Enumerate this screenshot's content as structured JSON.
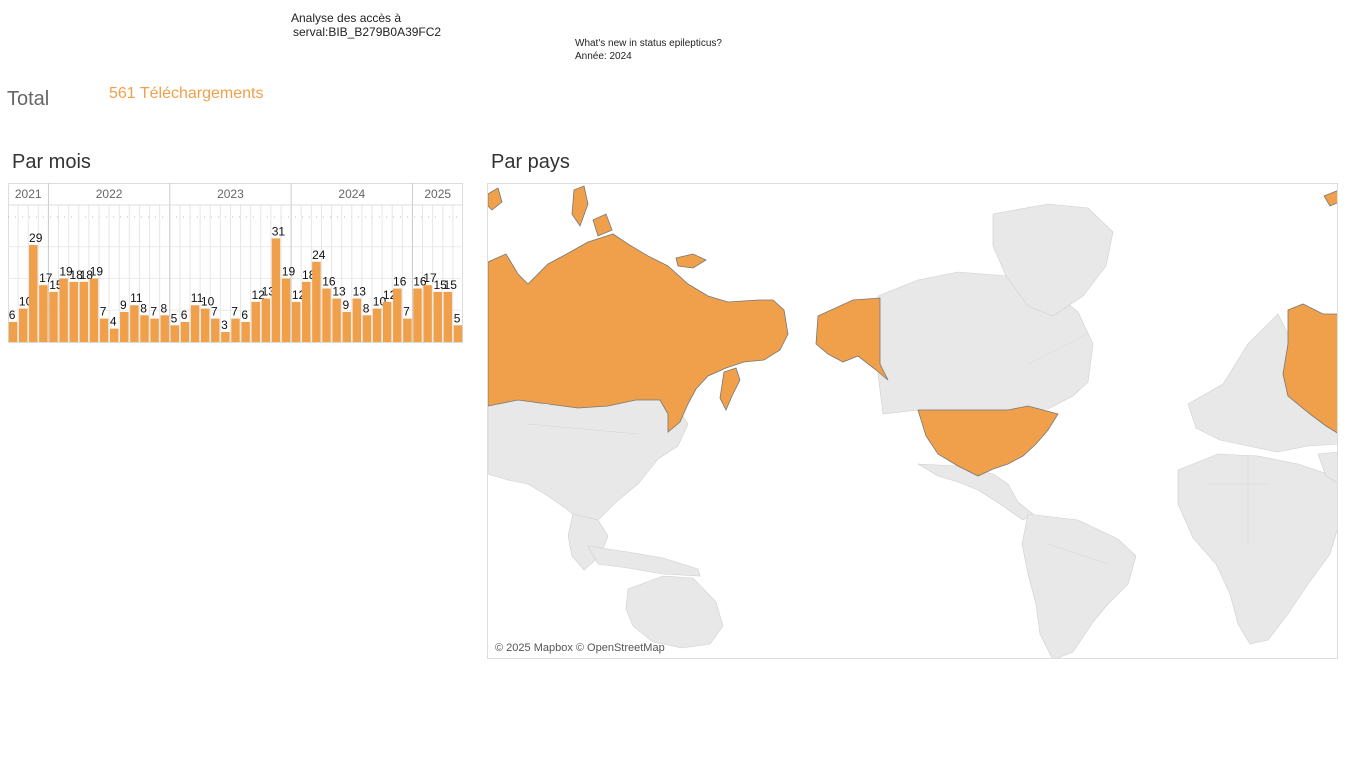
{
  "header": {
    "title_line1": "Analyse des accès à",
    "title_line2": "serval:BIB_B279B0A39FC2",
    "doc_title": "What's new in status epilepticus?",
    "doc_year": "Année: 2024"
  },
  "total": {
    "label": "Total",
    "value": "561 Téléchargements"
  },
  "sections": {
    "monthly": "Par mois",
    "country": "Par pays"
  },
  "colors": {
    "bar": "#f0a04b",
    "map_land": "#e8e8e8",
    "map_highlight": "#f0a04b",
    "border": "#777777"
  },
  "chart_data": {
    "type": "bar",
    "years": [
      {
        "label": "2021",
        "count": 4
      },
      {
        "label": "2022",
        "count": 12
      },
      {
        "label": "2023",
        "count": 12
      },
      {
        "label": "2024",
        "count": 12
      },
      {
        "label": "2025",
        "count": 5
      }
    ],
    "values": [
      6,
      10,
      29,
      17,
      15,
      19,
      18,
      18,
      19,
      7,
      4,
      9,
      11,
      8,
      7,
      8,
      5,
      6,
      11,
      10,
      7,
      3,
      7,
      6,
      12,
      13,
      31,
      19,
      12,
      18,
      24,
      16,
      13,
      9,
      13,
      8,
      10,
      12,
      16,
      7,
      16,
      17,
      15,
      15,
      5
    ],
    "labels": [
      "6",
      "10",
      "29",
      "17",
      "15",
      "19",
      "18",
      "18",
      "19",
      "7",
      "4",
      "9",
      "11",
      "8",
      "7",
      "8",
      "5",
      "6",
      "11",
      "10",
      "7",
      "3",
      "7",
      "6",
      "12",
      "13",
      "31",
      "19",
      "12",
      "18",
      "24",
      "16",
      "13",
      "9",
      "13",
      "8",
      "10",
      "12",
      "16",
      "7",
      "16",
      "17",
      "15",
      "15",
      "5"
    ],
    "ylim": [
      0,
      38
    ],
    "grid": true
  },
  "map": {
    "credit": "© 2025 Mapbox © OpenStreetMap",
    "highlighted_countries": [
      "Russia",
      "United States"
    ]
  }
}
